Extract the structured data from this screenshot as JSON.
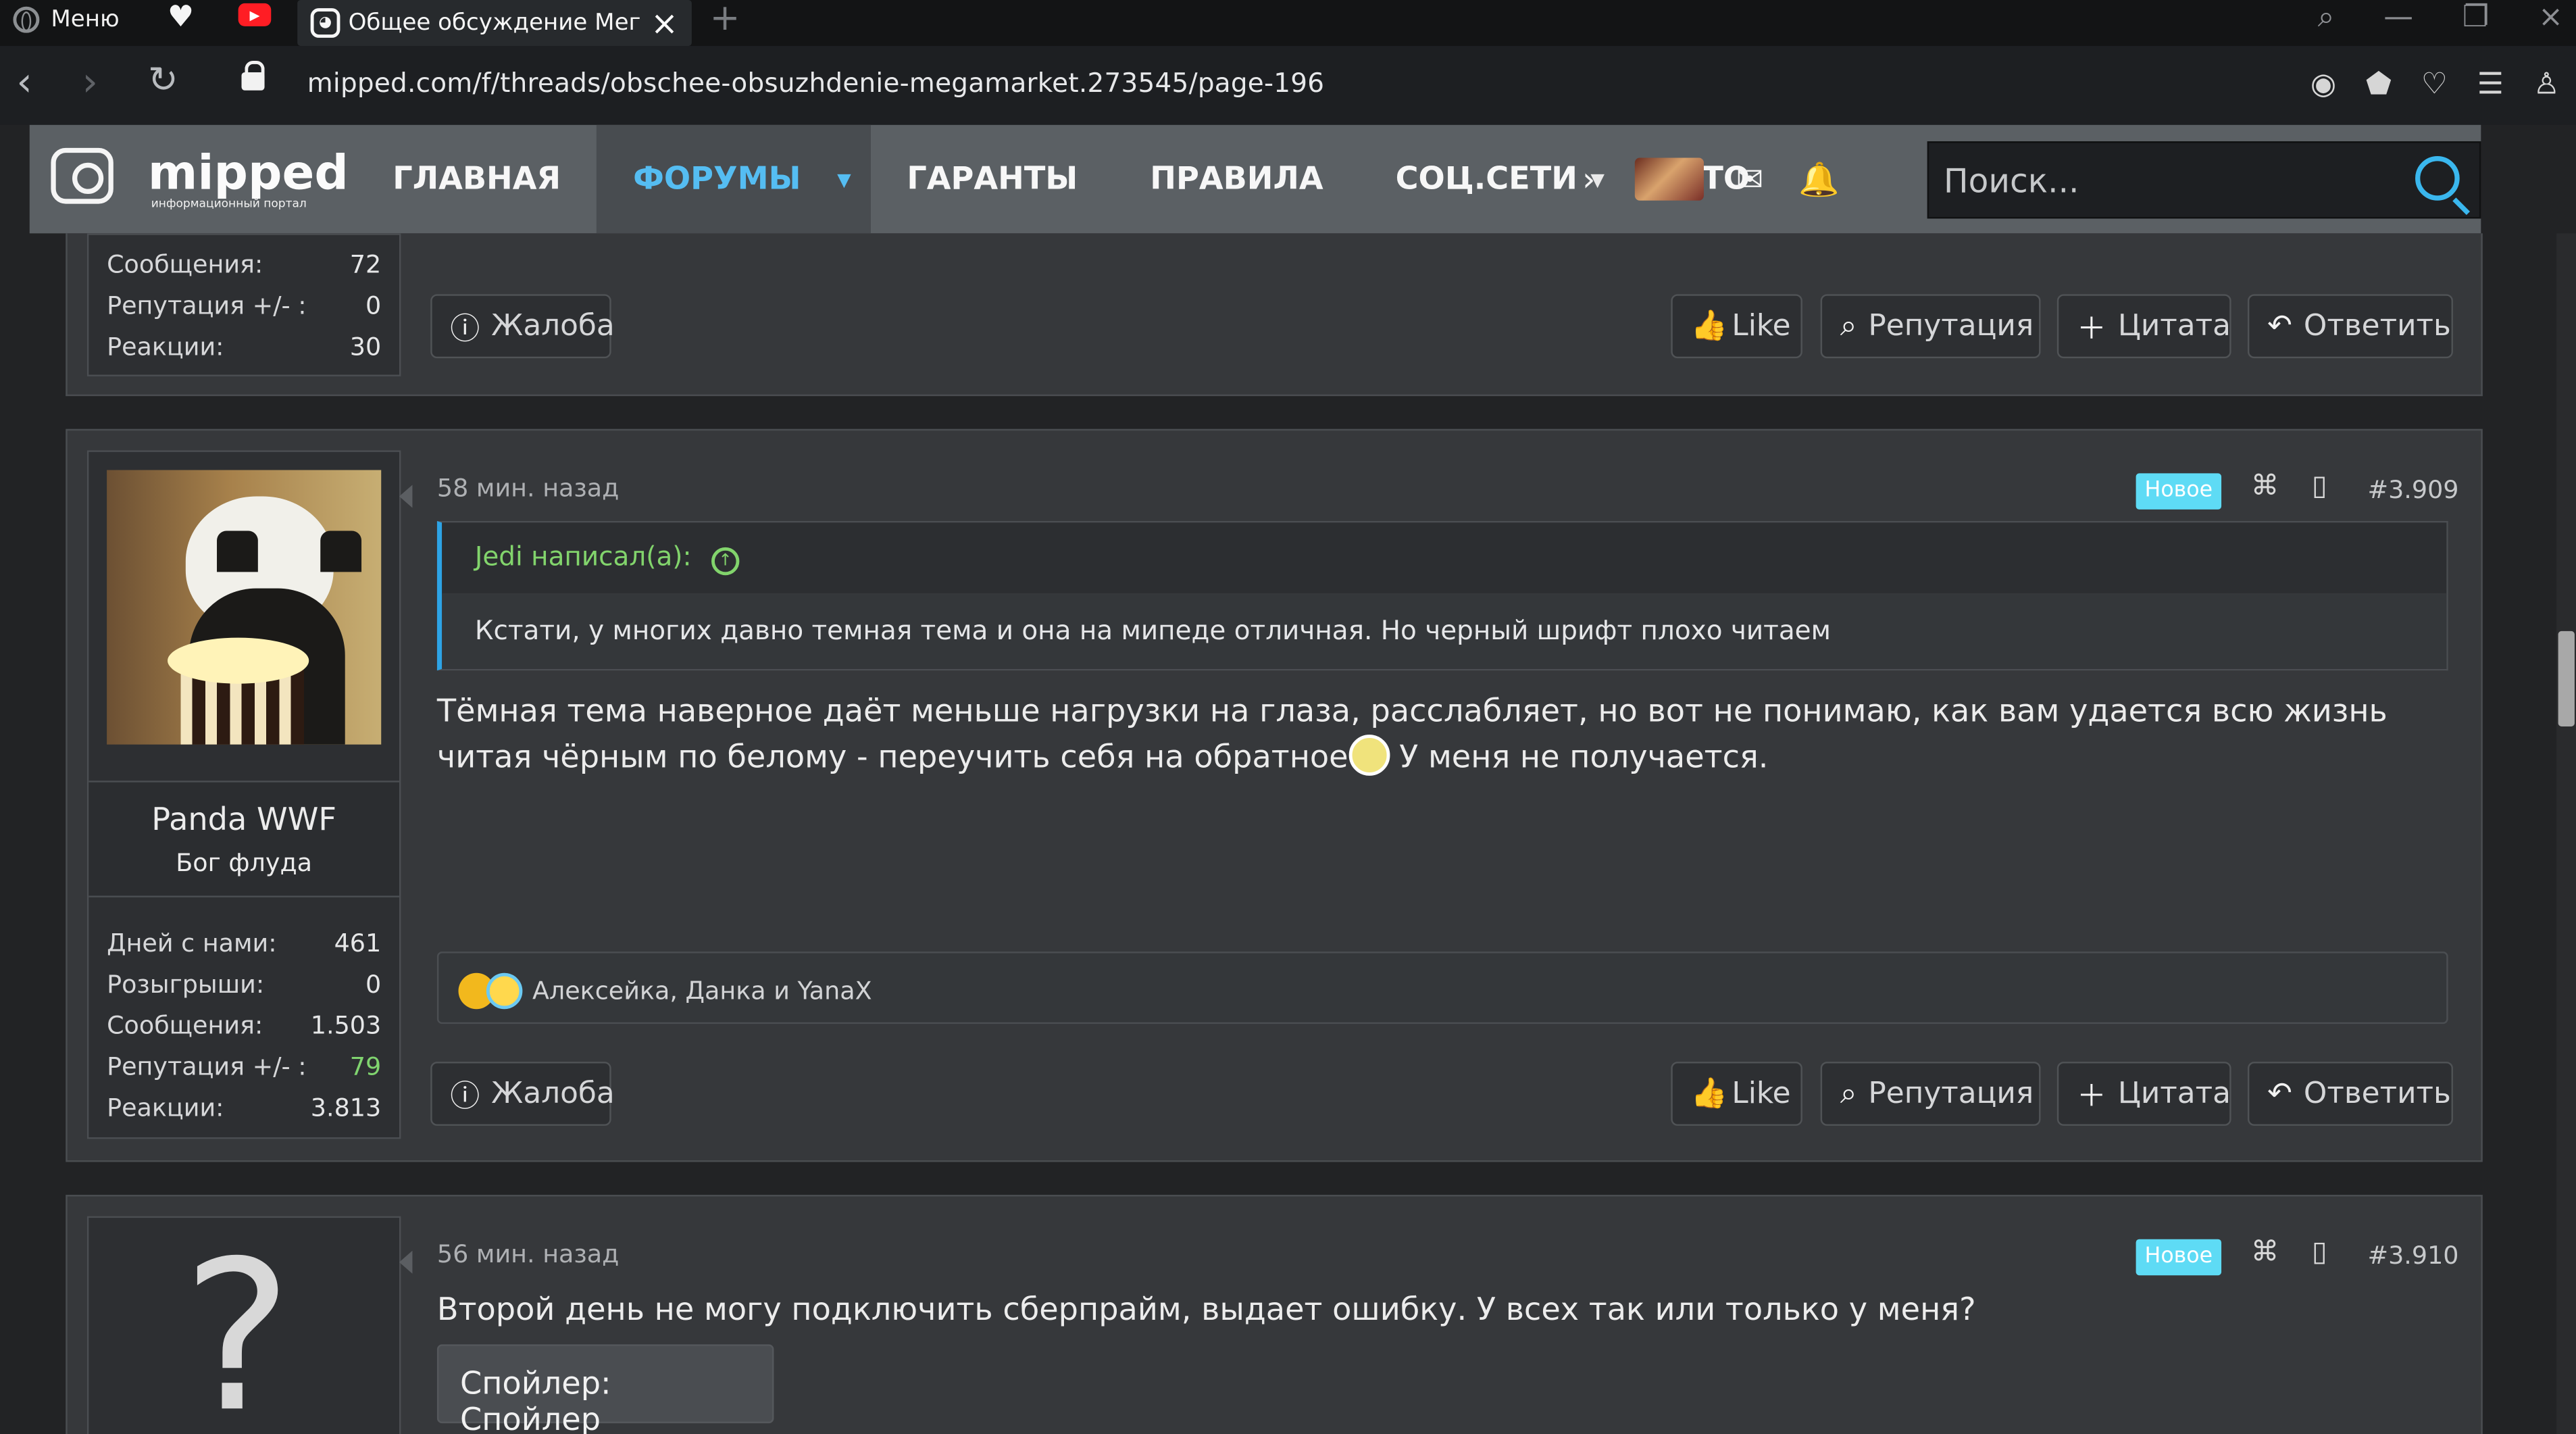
{
  "browser": {
    "menu_label": "Меню",
    "tab_title": "Общее обсуждение Мегамаркет",
    "url": "mipped.com/f/threads/obschee-obsuzhdenie-megamarket.273545/page-196"
  },
  "forum_nav": {
    "logo_word": "mipped",
    "logo_subtitle": "информационный портал",
    "items": [
      "ГЛАВНАЯ",
      "ФОРУМЫ",
      "ГАРАНТЫ",
      "ПРАВИЛА",
      "СОЦ.СЕТИ",
      "ЧТО"
    ],
    "search_placeholder": "Поиск..."
  },
  "post_previous": {
    "stats": [
      {
        "label": "Сообщения:",
        "value": "72"
      },
      {
        "label": "Репутация +/- :",
        "value": "0"
      },
      {
        "label": "Реакции:",
        "value": "30"
      }
    ],
    "actions": {
      "report": "Жалоба",
      "like": "Like",
      "reputation": "Репутация",
      "quote": "Цитата",
      "reply": "Ответить"
    }
  },
  "post_main": {
    "time": "58 мин. назад",
    "badge": "Новое",
    "number": "#3.909",
    "author": {
      "name": "Panda WWF",
      "role": "Бог флуда"
    },
    "stats": [
      {
        "label": "Дней с нами:",
        "value": "461",
        "color": "#e6e7e8"
      },
      {
        "label": "Розыгрыши:",
        "value": "0",
        "color": "#e6e7e8"
      },
      {
        "label": "Сообщения:",
        "value": "1.503",
        "color": "#e6e7e8"
      },
      {
        "label": "Репутация +/- :",
        "value": "79",
        "color": "#80d46f"
      },
      {
        "label": "Реакции:",
        "value": "3.813",
        "color": "#e6e7e8"
      }
    ],
    "quote": {
      "author_line": "Jedi написал(а):",
      "text": "Кстати, у многих давно темная тема и она на мипеде отличная. Но черный шрифт плохо читаем"
    },
    "text_before_emoji": "Тёмная тема наверное даёт меньше нагрузки на глаза, расслабляет, но вот не понимаю, как вам удается всю жизнь читая чёрным по белому - переучить себя на обратное",
    "text_after_emoji": " У меня не получается.",
    "reactions": "Алексейка, Данка и YanaX",
    "actions": {
      "report": "Жалоба",
      "like": "Like",
      "reputation": "Репутация",
      "quote": "Цитата",
      "reply": "Ответить"
    }
  },
  "post_next": {
    "time": "56 мин. назад",
    "badge": "Новое",
    "number": "#3.910",
    "text": "Второй день не могу подключить сберпрайм, выдает ошибку. У всех так или только у меня?",
    "spoiler": "Спойлер: Спойлер"
  },
  "colors": {
    "accent": "#55bdf2",
    "new_badge": "#5edbf5",
    "positive_reputation": "#80d46f"
  },
  "icons": [
    "search-icon",
    "bell-icon",
    "mail-icon",
    "share-icon",
    "bookmark-icon",
    "thumbs-up-icon",
    "quote-plus-icon",
    "reply-icon",
    "warning-icon"
  ]
}
